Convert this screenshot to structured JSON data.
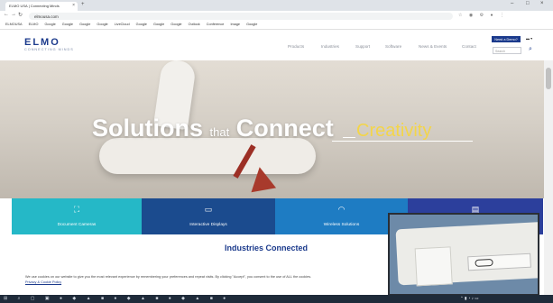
{
  "browser": {
    "tab_title": "ELMO USA | Connecting Minds",
    "url": "elmousa.com",
    "bookmarks": [
      "ELMOUSA",
      "ELMO",
      "Google",
      "Google",
      "Google",
      "Google",
      "LiveCloud",
      "Google",
      "Google",
      "Google",
      "Outlook",
      "Conference",
      "Image",
      "Google"
    ]
  },
  "site": {
    "logo": "ELMO",
    "logo_sub": "CONNECTING MINDS",
    "nav": [
      "Products",
      "Industries",
      "Support",
      "Software",
      "News & Events",
      "Contact"
    ],
    "demo_button": "Need a Demo?",
    "search_placeholder": "Search"
  },
  "hero": {
    "word1": "Solutions",
    "word2": "that",
    "word3": "Connect",
    "accent": "Creativity"
  },
  "tiles": [
    {
      "label": "Document Cameras",
      "icon": "camera-icon",
      "color": "#25b8c7"
    },
    {
      "label": "Interactive Displays",
      "icon": "display-icon",
      "color": "#1b4b8e"
    },
    {
      "label": "Wireless Solutions",
      "icon": "wireless-icon",
      "color": "#1e7cc3"
    },
    {
      "label": "Software",
      "icon": "software-icon",
      "color": "#2c3f9c"
    }
  ],
  "content": {
    "industries_title": "Industries Connected",
    "cookie_text": "We use cookies on our website to give you the most relevant experience by remembering your preferences and repeat visits. By clicking \"Accept\", you consent to the use of ALL the cookies.",
    "cookie_link": "Privacy & Cookie Policy"
  },
  "colors": {
    "brand": "#1b3a8c",
    "accent": "#f3d54a"
  }
}
